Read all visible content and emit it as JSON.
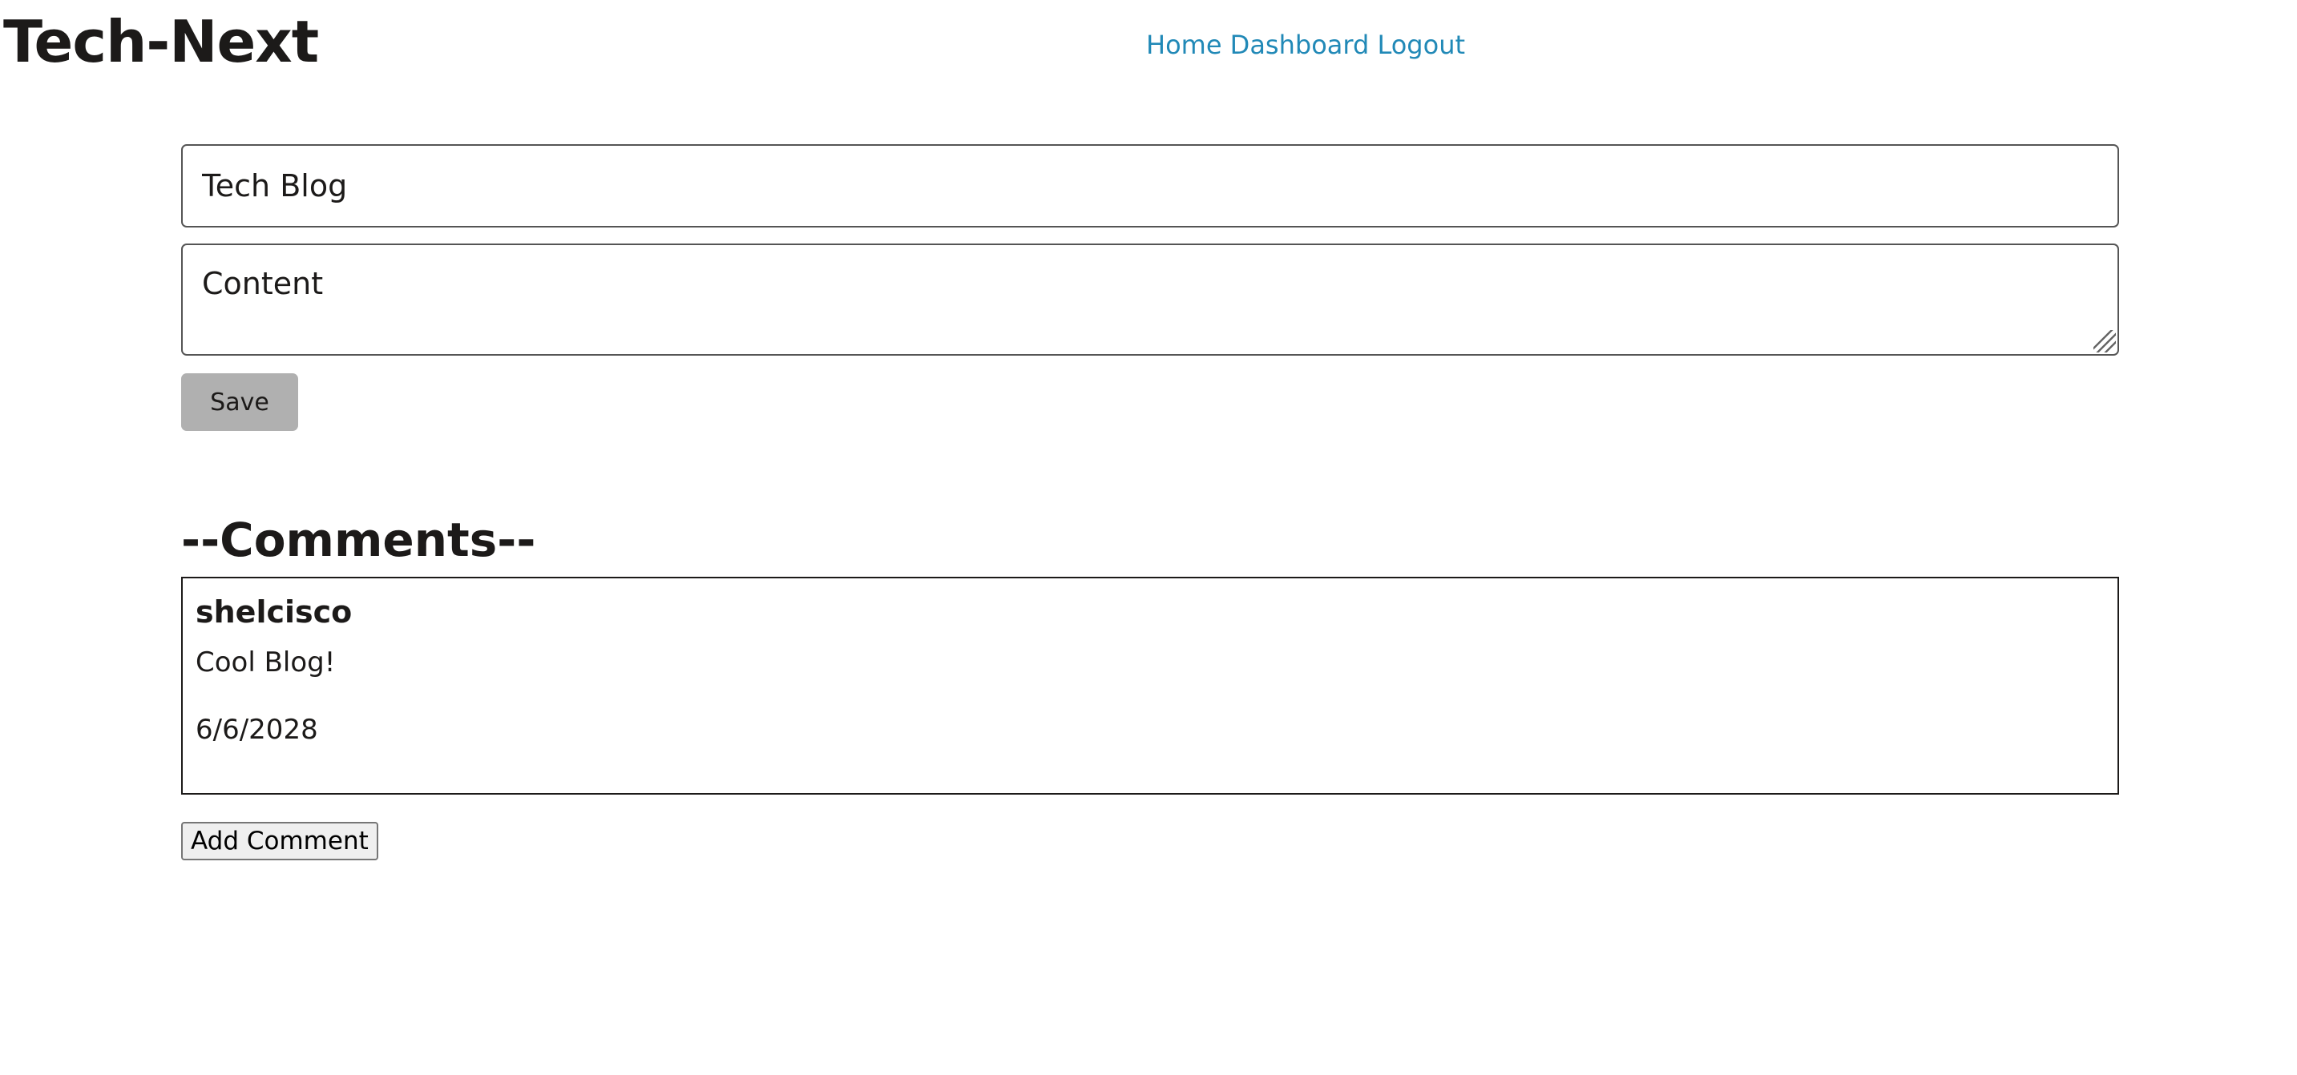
{
  "header": {
    "site_title": "Tech-Next",
    "nav": [
      {
        "label": "Home"
      },
      {
        "label": "Dashboard"
      },
      {
        "label": "Logout"
      }
    ],
    "nav_color": "#2189b7"
  },
  "post_form": {
    "title_value": "Tech Blog",
    "content_value": "Content",
    "save_label": "Save",
    "save_button_color": "#b0b0b0"
  },
  "comments": {
    "heading": "--Comments--",
    "items": [
      {
        "author": "shelcisco",
        "text": "Cool Blog!",
        "date": "6/6/2028"
      }
    ],
    "add_label": "Add Comment"
  }
}
